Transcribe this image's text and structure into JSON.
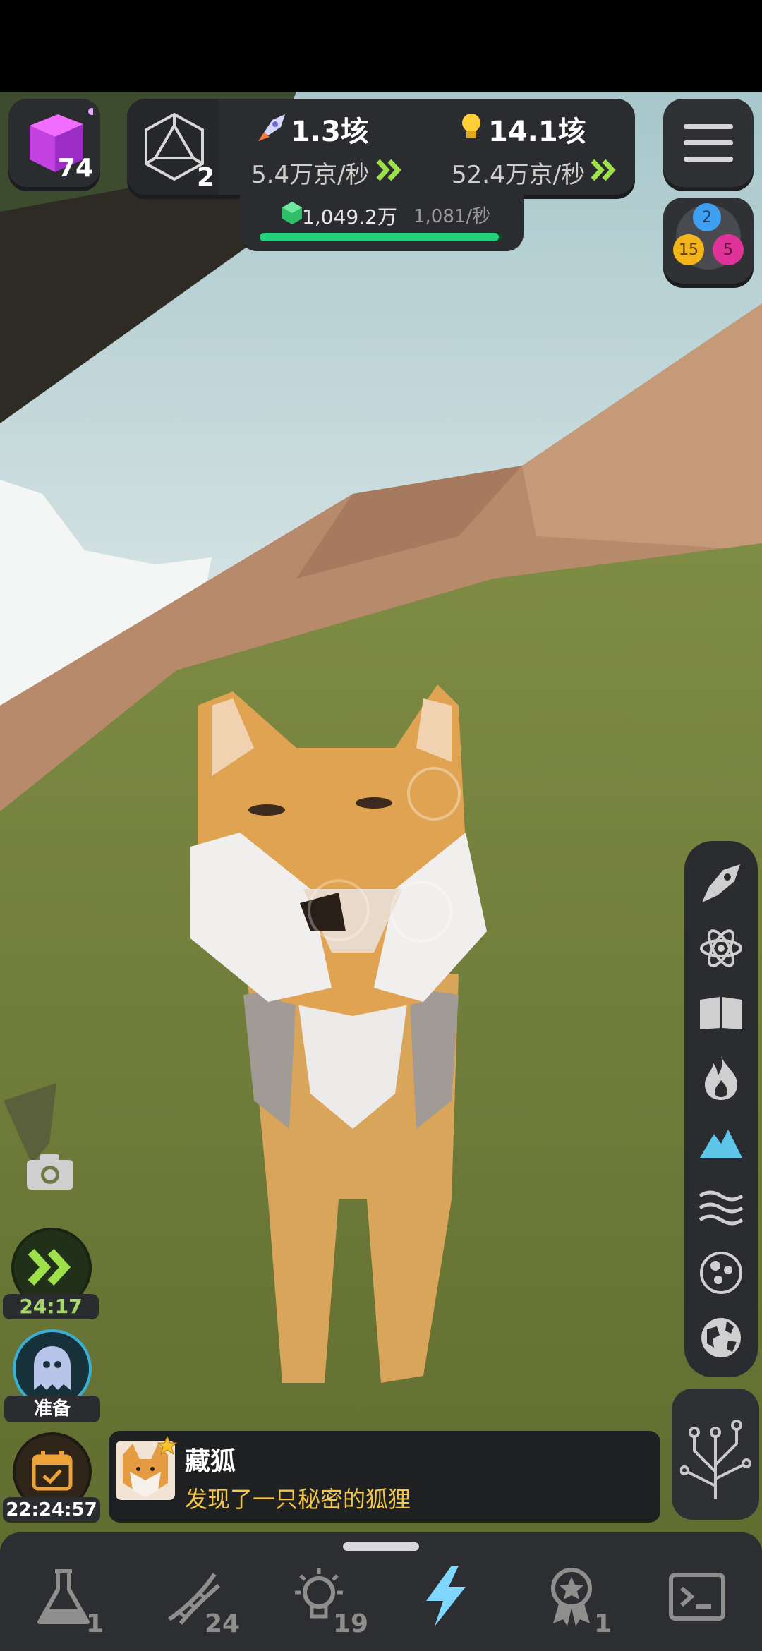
{
  "top_bar": {
    "cube_count": "74",
    "dice_level": "2",
    "rocket_value": "1.3垓",
    "rocket_rate": "5.4万京/秒",
    "bulb_value": "14.1垓",
    "bulb_rate": "52.4万京/秒",
    "gem_value": "1,049.2万",
    "gem_rate": "1,081/秒",
    "gem_progress": 0.98
  },
  "currency_orbs": {
    "blue": "2",
    "yellow": "15",
    "pink": "5"
  },
  "left_controls": {
    "boost_timer": "24:17",
    "ghost_label": "准备",
    "calendar_timer": "22:24:57"
  },
  "notification": {
    "title": "藏狐",
    "message": "发现了一只秘密的狐狸"
  },
  "side_menu": {
    "items": [
      "rocket-icon",
      "atom-icon",
      "book-icon",
      "fire-icon",
      "mountain-icon",
      "waves-icon",
      "cells-icon",
      "globe-icon"
    ],
    "active": "mountain-icon"
  },
  "bottom_nav": {
    "items": [
      {
        "icon": "flask-icon",
        "count": "1"
      },
      {
        "icon": "dna-icon",
        "count": "24"
      },
      {
        "icon": "lightbulb-icon",
        "count": "19"
      },
      {
        "icon": "lightning-icon",
        "count": ""
      },
      {
        "icon": "medal-icon",
        "count": "1"
      },
      {
        "icon": "terminal-icon",
        "count": ""
      }
    ],
    "active": "lightning-icon"
  },
  "colors": {
    "accent_green": "#9ee04a",
    "accent_blue": "#5ec6e8",
    "lightning_blue": "#7fd7ff",
    "notification_text": "#f2c54b",
    "progress_green": "#22d17a"
  }
}
